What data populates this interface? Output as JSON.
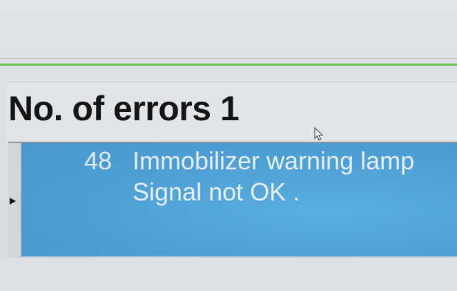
{
  "header": {
    "title": "No. of errors 1"
  },
  "errors": [
    {
      "code": "48",
      "description": "Immobilizer warning lamp",
      "detail": "Signal not OK ."
    }
  ],
  "colors": {
    "accent_line": "#6bbf4c",
    "selected_row": "#4e9fd6",
    "background": "#d9dde1"
  },
  "icons": {
    "cursor": "mouse-pointer-icon",
    "row_pointer": "row-pointer-icon"
  }
}
